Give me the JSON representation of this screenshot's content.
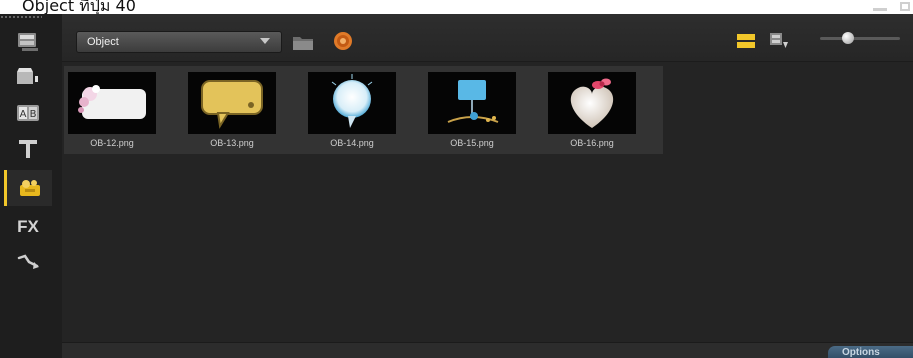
{
  "caption": {
    "text": "Object ที่ปุ่ม 40"
  },
  "sidebar": {
    "items": [
      {
        "name": "media-icon"
      },
      {
        "name": "instant-project-icon"
      },
      {
        "name": "transition-icon"
      },
      {
        "name": "title-icon"
      },
      {
        "name": "graphic-object-icon",
        "active": true
      },
      {
        "name": "fx-filter-icon",
        "label": "FX"
      },
      {
        "name": "motion-path-icon"
      }
    ]
  },
  "toolbar": {
    "dropdown": {
      "selected": "Object"
    }
  },
  "library": {
    "thumbnails": [
      {
        "label": "OB-12.png",
        "shape": "frame-flowers"
      },
      {
        "label": "OB-13.png",
        "shape": "speech-bubble-yellow"
      },
      {
        "label": "OB-14.png",
        "shape": "thought-bubble-glow"
      },
      {
        "label": "OB-15.png",
        "shape": "bird-sign"
      },
      {
        "label": "OB-16.png",
        "shape": "heart-bow"
      }
    ]
  },
  "status": {
    "options_label": "Options"
  },
  "colors": {
    "background": "#262626",
    "sidebar": "#1e1e1e",
    "accent_yellow": "#f2c72a",
    "options_blue": "#3a5a76"
  }
}
